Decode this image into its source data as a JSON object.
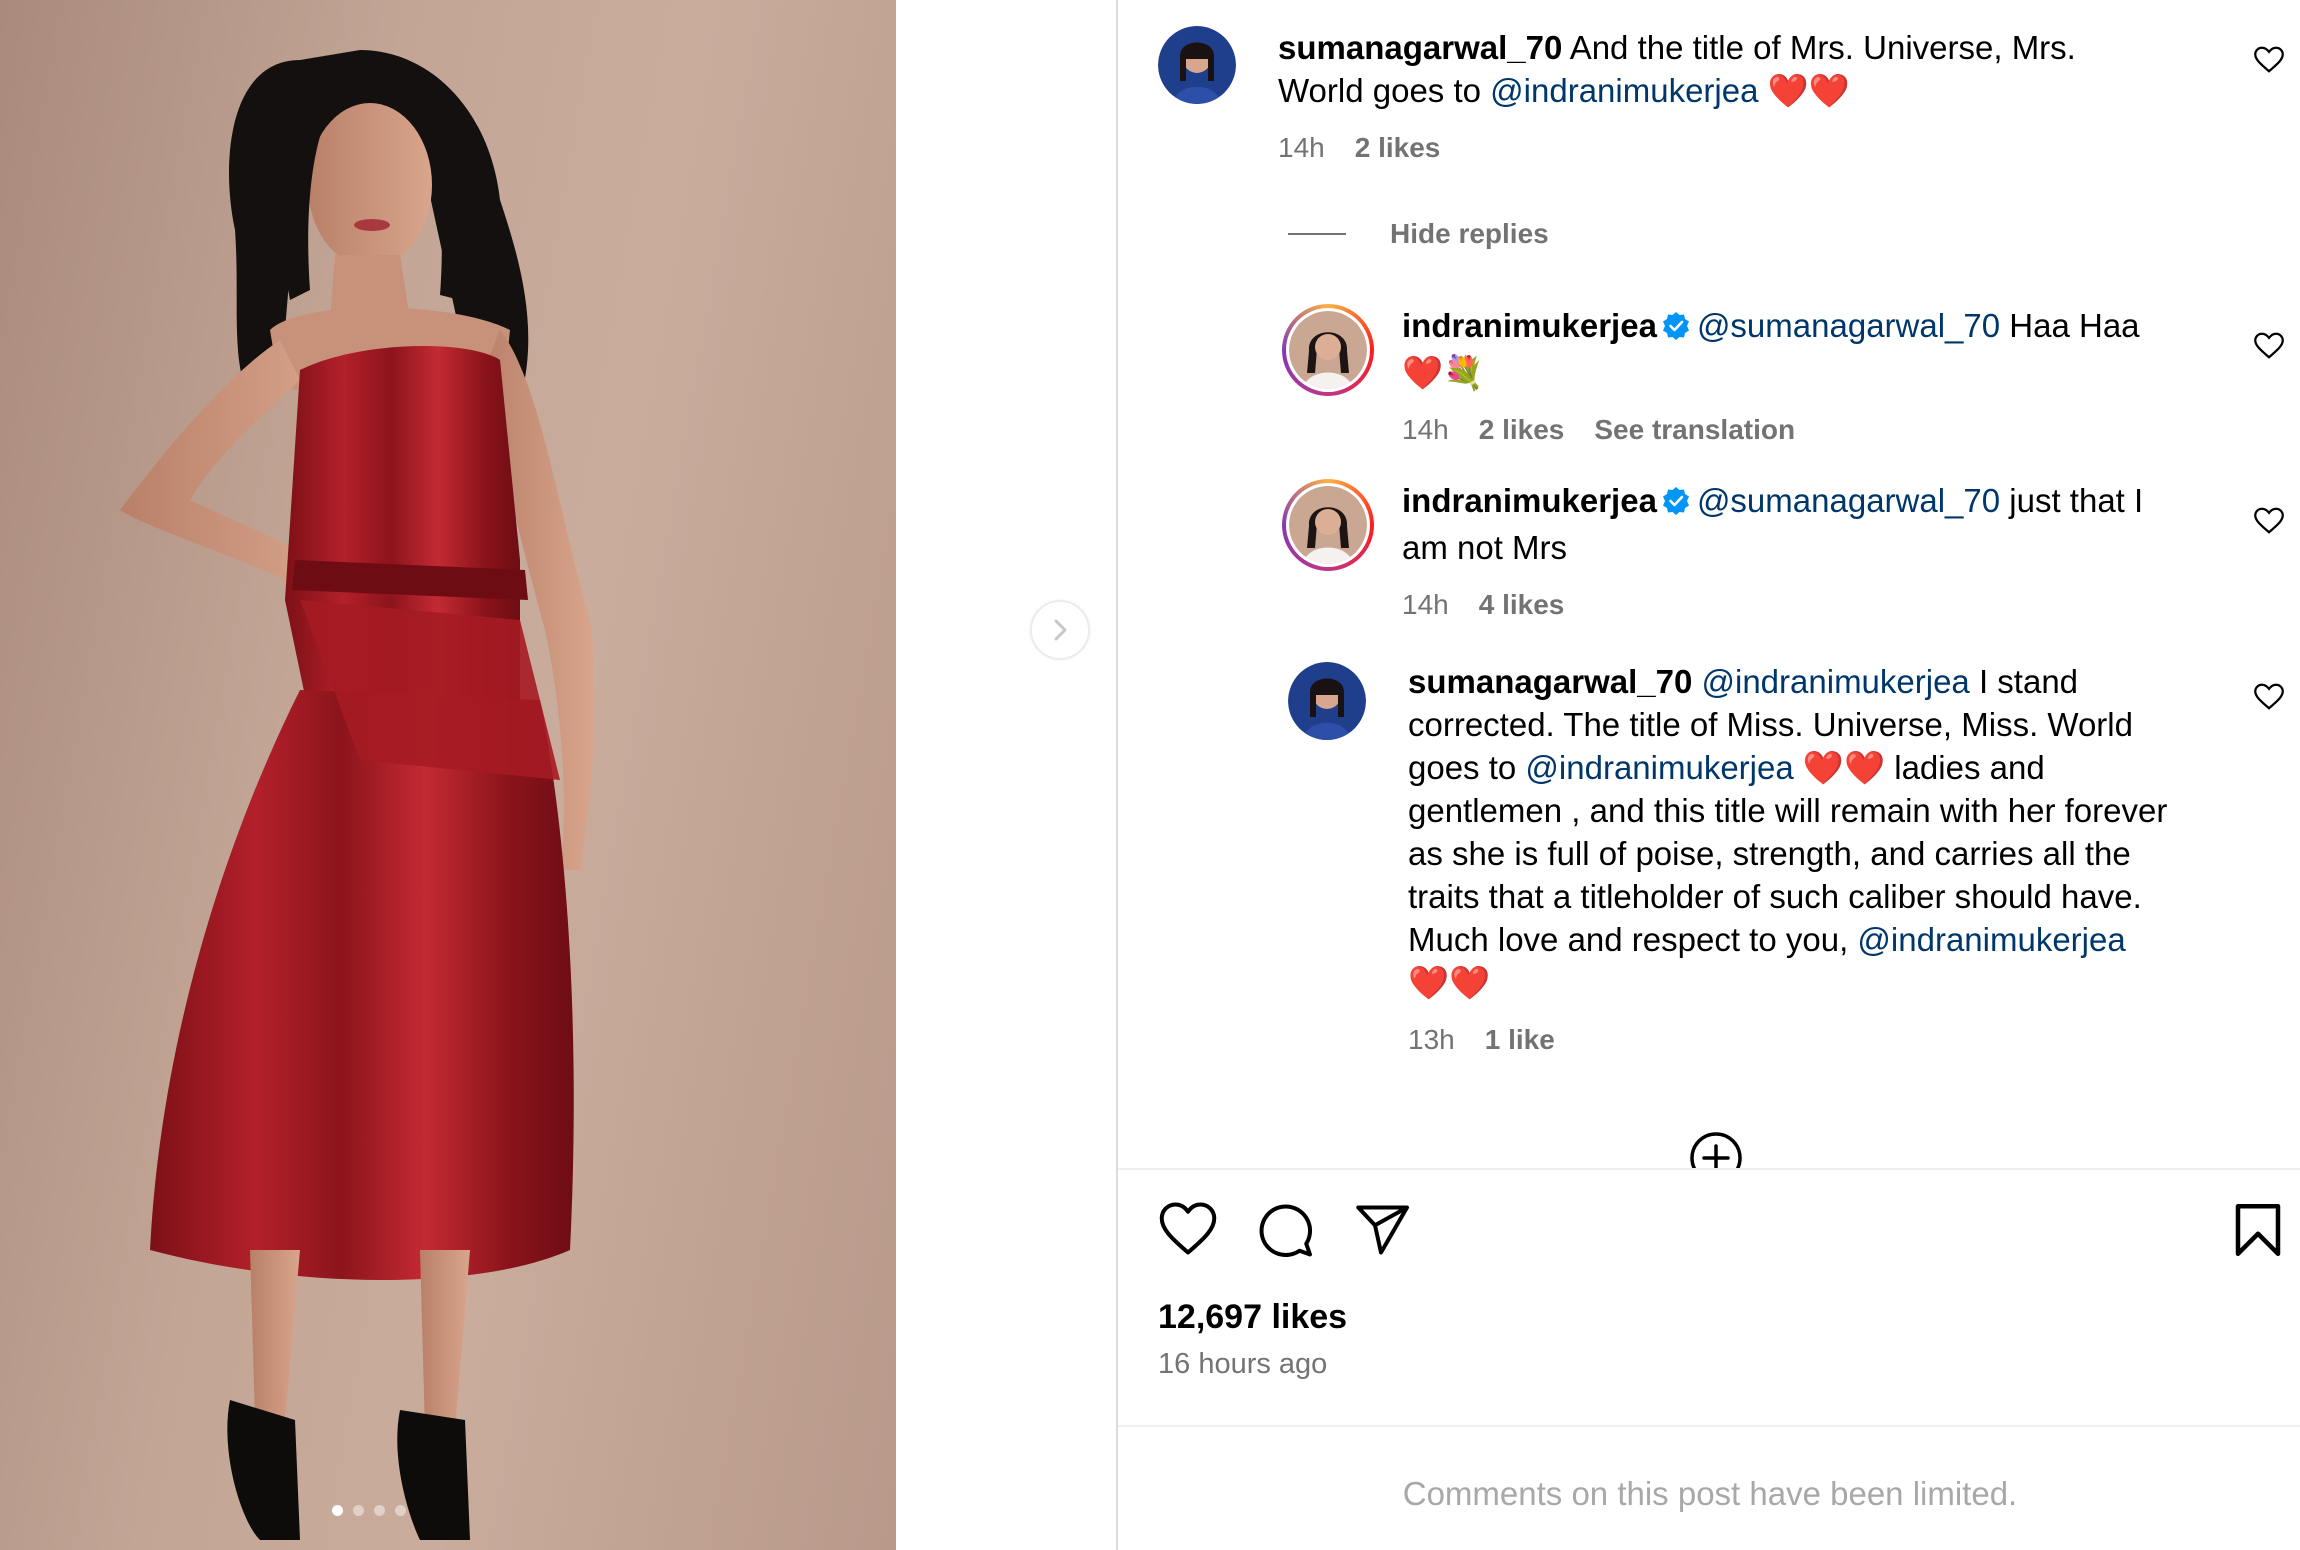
{
  "post": {
    "image_alt": "Woman in red satin dress posing",
    "carousel": {
      "total": 4,
      "active": 0
    }
  },
  "comments": [
    {
      "username": "sumanagarwal_70",
      "verified": false,
      "text_line1": "And the title of Mrs. Universe, Mrs.",
      "text_line2_prefix": "World goes to ",
      "text_line2_mention": "@indranimukerjea",
      "text_line2_suffix": " ❤️❤️",
      "time": "14h",
      "likes": "2 likes"
    }
  ],
  "replies_toggle": "Hide replies",
  "replies": [
    {
      "username": "indranimukerjea",
      "verified": true,
      "mention": "@sumanagarwal_70",
      "text": " Haa Haa",
      "text_line2": "❤️💐",
      "time": "14h",
      "likes": "2 likes",
      "translation": "See translation"
    },
    {
      "username": "indranimukerjea",
      "verified": true,
      "mention": "@sumanagarwal_70",
      "text": " just that I",
      "text_line2": "am not Mrs",
      "time": "14h",
      "likes": "4 likes"
    },
    {
      "username": "sumanagarwal_70",
      "verified": false,
      "mention": "@indranimukerjea",
      "line1": " I stand",
      "line2": "corrected. The title of Miss. Universe, Miss. World",
      "line3_prefix": "goes to ",
      "line3_mention": "@indranimukerjea",
      "line3_suffix": " ❤️❤️ ladies and",
      "line4": "gentlemen , and this title will remain with her forever",
      "line5": "as she is full of poise, strength, and carries all the",
      "line6": "traits that a titleholder of such caliber should have.",
      "line7_prefix": "Much love and respect to you, ",
      "line7_mention": "@indranimukerjea",
      "line8": "❤️❤️",
      "time": "13h",
      "likes": "1 like"
    }
  ],
  "actions": {
    "like_icon": "heart-icon",
    "comment_icon": "comment-icon",
    "share_icon": "paper-plane-icon",
    "save_icon": "bookmark-icon"
  },
  "likes_total": "12,697 likes",
  "posted_ago": "16 hours ago",
  "comments_limited": "Comments on this post have been limited.",
  "colors": {
    "mention": "#00376b",
    "meta": "#737373",
    "dress": "#9e1a22",
    "verified": "#0095f6"
  }
}
